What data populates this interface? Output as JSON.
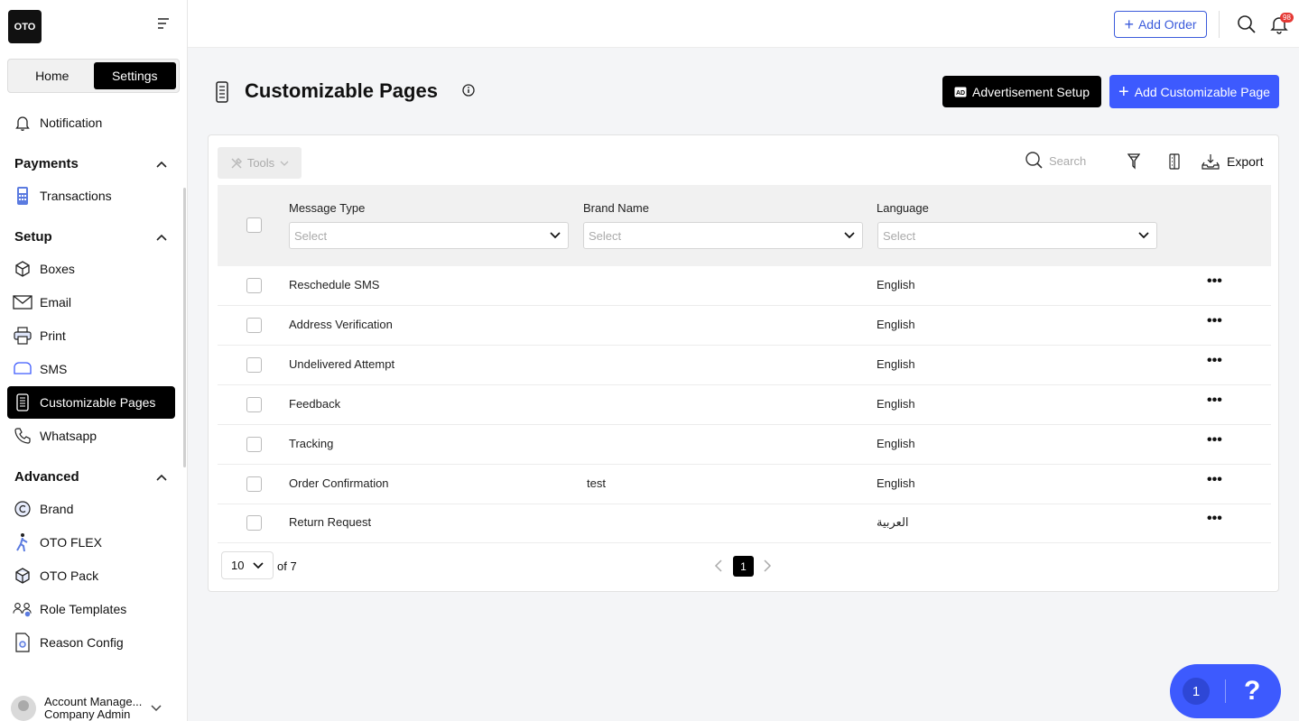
{
  "sidebar": {
    "logo": "OTO",
    "toggle": {
      "home": "Home",
      "settings": "Settings"
    },
    "notification": "Notification",
    "payments": {
      "title": "Payments",
      "transactions": "Transactions"
    },
    "setup": {
      "title": "Setup",
      "items": [
        "Boxes",
        "Email",
        "Print",
        "SMS",
        "Customizable Pages",
        "Whatsapp"
      ]
    },
    "advanced": {
      "title": "Advanced",
      "items": [
        "Brand",
        "OTO FLEX",
        "OTO Pack",
        "Role Templates",
        "Reason Config"
      ]
    },
    "account": {
      "name": "Account Manage...",
      "role": "Company Admin"
    }
  },
  "topbar": {
    "add_order": "Add Order",
    "notification_count": "98"
  },
  "page": {
    "title": "Customizable Pages",
    "advertisement_button": "Advertisement Setup",
    "add_button": "Add Customizable Page"
  },
  "toolbar": {
    "tools": "Tools",
    "search_placeholder": "Search",
    "export": "Export"
  },
  "table": {
    "columns": [
      "Message Type",
      "Brand Name",
      "Language"
    ],
    "filter_placeholder": "Select",
    "rows": [
      {
        "message_type": "Reschedule SMS",
        "brand": "",
        "language": "English"
      },
      {
        "message_type": "Address Verification",
        "brand": "",
        "language": "English"
      },
      {
        "message_type": "Undelivered Attempt",
        "brand": "",
        "language": "English"
      },
      {
        "message_type": "Feedback",
        "brand": "",
        "language": "English"
      },
      {
        "message_type": "Tracking",
        "brand": "",
        "language": "English"
      },
      {
        "message_type": "Order Confirmation",
        "brand": "test",
        "language": "English"
      },
      {
        "message_type": "Return Request",
        "brand": "",
        "language": "العربية"
      }
    ],
    "more": "•••"
  },
  "pagination": {
    "page_size": "10",
    "of_total": "of 7",
    "current_page": "1"
  },
  "help_widget": {
    "count": "1",
    "label": "?"
  }
}
